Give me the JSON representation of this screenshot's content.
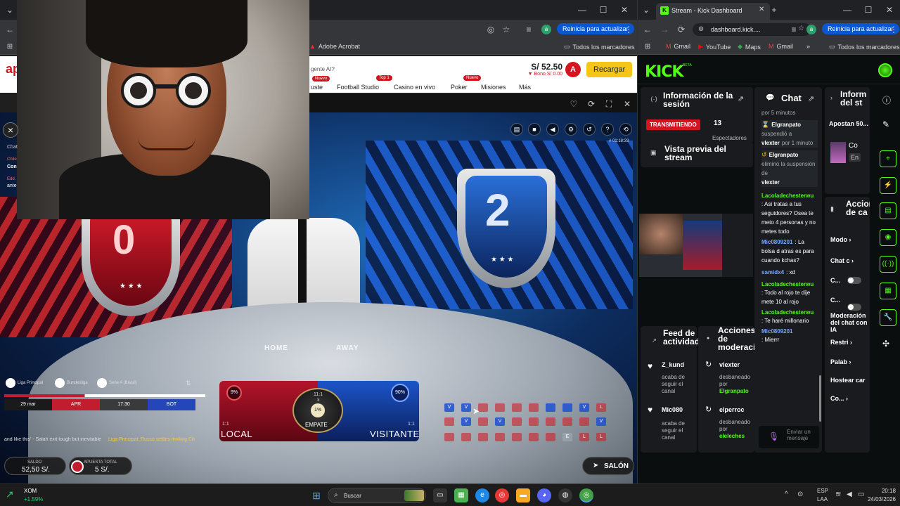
{
  "left_browser": {
    "update_label": "Reinicia para actualizar",
    "bookmark_acrobat": "Adobe Acrobat",
    "bookmark_all": "Todos los marcadores",
    "avatar_letter": "a"
  },
  "site": {
    "logo_fragment": "ap",
    "promo_fragment": "gente AI?",
    "nav": [
      {
        "label": "uste",
        "badge": "Nuevo"
      },
      {
        "label": "Football Studio",
        "badge": ""
      },
      {
        "label": "Casino en vivo",
        "badge": "Top 1"
      },
      {
        "label": "Poker",
        "badge": "Nuevo"
      },
      {
        "label": "Misiones",
        "badge": ""
      },
      {
        "label": "Más",
        "badge": ""
      }
    ],
    "balance": "S/ 52.50",
    "bonus": "▼ Bono S/ 0.00",
    "user_initial": "A",
    "recharge_label": "Recargar"
  },
  "game": {
    "round_id": "# 01:18:33",
    "left_shield_digit": "0",
    "right_shield_digit": "2",
    "home_label": "HOME",
    "away_label": "AWAY",
    "local_label": "LOCAL",
    "local_odds": "1:1",
    "local_pct": "9%",
    "visit_label": "VISITANTE",
    "visit_odds": "1:1",
    "visit_pct": "90%",
    "draw_label": "EMPATE",
    "draw_odds": "11:1",
    "draw_pct": "1%",
    "draw_x": "x",
    "chip_value": "5",
    "leagues": [
      "Liga Principal",
      "Bundesliga",
      "Serie A (Brasil)"
    ],
    "match": {
      "date": "29 mar",
      "tag": "APR",
      "time": "17:30",
      "badge": "BOT"
    },
    "ticker": "and like this' - Salah exit tough but inevitable",
    "ticker_2": "Liga Principal: Russo settles thrilling Ch",
    "saldo_label": "SALDO",
    "saldo_value": "52,50 S/.",
    "apuesta_label": "APUESTA TOTAL",
    "apuesta_value": "5 S/.",
    "salon_label": "SALÓN",
    "history_row1": [
      "V",
      "V",
      "",
      "",
      "",
      "",
      "",
      "",
      "V",
      "L"
    ],
    "history_row2": [
      "",
      "V",
      "",
      "V",
      "",
      "",
      "",
      "",
      "",
      "V"
    ],
    "history_row3": [
      "",
      "",
      "",
      "",
      "",
      "",
      "",
      "E",
      "L",
      "L"
    ]
  },
  "webcam": {
    "side_notes": [
      "Chat",
      "Con",
      "Chile",
      "Edd.",
      "ante"
    ]
  },
  "right_browser": {
    "tab_title": "Stream - Kick Dashboard",
    "url": "dashboard.kick....",
    "update_label": "Reinicia para actualizar",
    "avatar_letter": "a",
    "bookmarks": [
      "Gmail",
      "YouTube",
      "Maps",
      "Gmail"
    ],
    "bookmark_all": "Todos los marcadores"
  },
  "kick": {
    "logo": "KICK",
    "logo_sup": "BETA",
    "session": {
      "title": "Información de la sesión",
      "live_badge": "TRANSMITIENDO",
      "viewers": "13",
      "viewers_label": "Espectadores"
    },
    "preview_title": "Vista previa del stream",
    "feed_title": "Feed de actividad",
    "feed_items": [
      {
        "user": "Z_kund",
        "action": "acaba de seguir el canal"
      },
      {
        "user": "Mic080",
        "action": "acaba de seguir el canal"
      }
    ],
    "mod_title": "Acciones de moderación",
    "mod_items": [
      {
        "user": "vlexter",
        "action": "desbaneado por",
        "by": "Elgranpato"
      },
      {
        "user": "elperroc",
        "action": "desbaneado por",
        "by": "eleleches"
      }
    ],
    "chat_title": "Chat",
    "chat": [
      {
        "kind": "sys",
        "text": "por 5 minutos"
      },
      {
        "kind": "sys",
        "user": "Elgranpato",
        "text": "suspendió a",
        "target": "vlexter",
        "tail": "por 1 minuto"
      },
      {
        "kind": "sys",
        "user": "Elgranpato",
        "text": "eliminó la suspensión de",
        "target": "vlexter",
        "tail": ""
      },
      {
        "kind": "msg",
        "user": "Lacoladechesterwu",
        "color": "green",
        "text": ": Asi tratas a tus seguidores? Osea te meto 4 personas y no metes todo"
      },
      {
        "kind": "msg",
        "user": "Mic0809201",
        "color": "blue",
        "text": ": La bolsa d atras es para cuando kchas?"
      },
      {
        "kind": "msg",
        "user": "samidx4",
        "color": "blue",
        "text": ": xd"
      },
      {
        "kind": "msg",
        "user": "Lacoladechesterwu",
        "color": "green",
        "text": ": Todo al rojo te dije mete 10 al rojo"
      },
      {
        "kind": "msg",
        "user": "Lacoladechesterwu",
        "color": "green",
        "text": ": Te haré millonario"
      },
      {
        "kind": "msg",
        "user": "Mic0809201",
        "color": "blue",
        "text": ": Mierrr"
      }
    ],
    "chat_input_placeholder": "Enviar un mensaje",
    "side_title": "Inform del st",
    "side_bet_title": "Apostan 50...",
    "side_co": "Co",
    "side_en": "En",
    "actions_title": "Acciones de ca",
    "actions": [
      "Modo",
      "Chat c",
      "C...",
      "C...",
      "Moderación del chat con IA",
      "Restri",
      "Palab",
      "Hostear car",
      "Co..."
    ]
  },
  "taskbar": {
    "stock_symbol": "XOM",
    "stock_change": "+1.59%",
    "search_placeholder": "Buscar",
    "lang": "ESP",
    "lang_sub": "LAA",
    "time": "20:18",
    "date": "24/03/2026"
  },
  "colors": {
    "kick_green": "#53fc18",
    "red": "#d3151f",
    "blue": "#1c55c9",
    "yellow": "#f5c518"
  }
}
